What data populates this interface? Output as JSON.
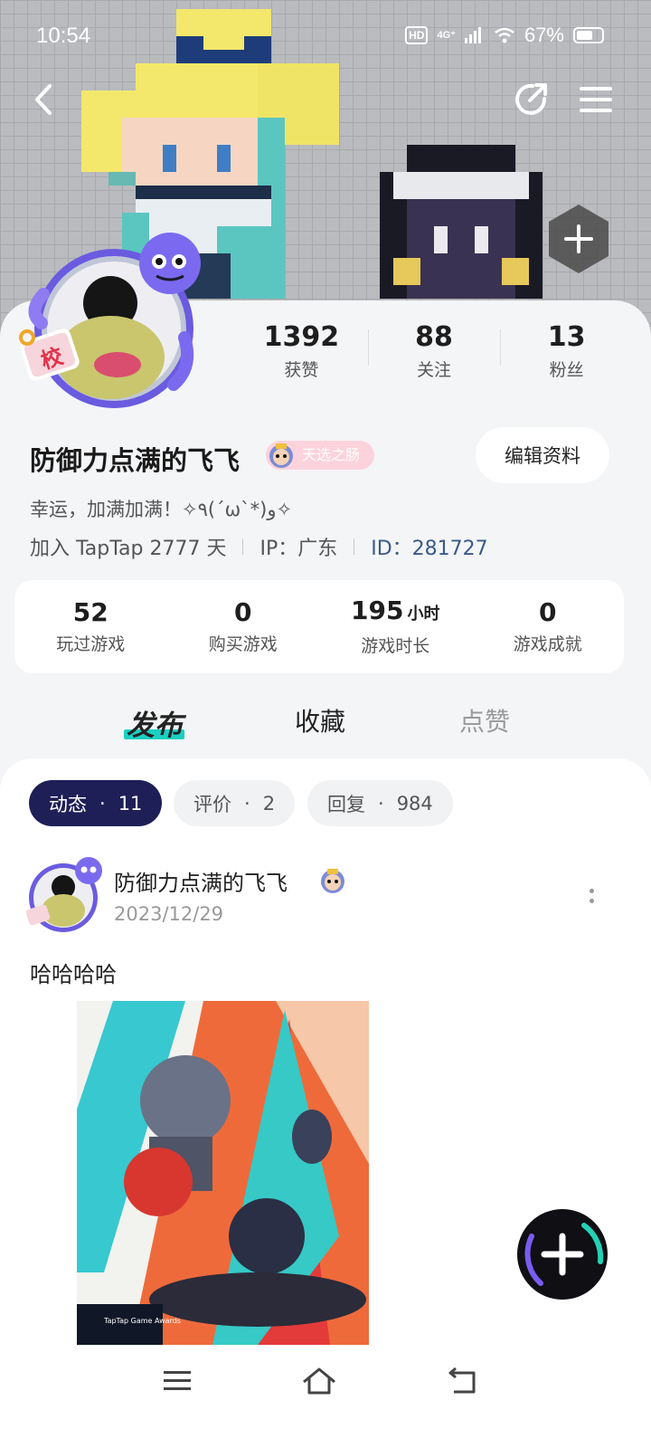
{
  "status_bar": {
    "time": "10:54",
    "hd": "HD",
    "network": "4G⁺",
    "battery": "67%",
    "battery_level": 0.67
  },
  "profile": {
    "stats": [
      {
        "value": "1392",
        "label": "获赞"
      },
      {
        "value": "88",
        "label": "关注"
      },
      {
        "value": "13",
        "label": "粉丝"
      }
    ],
    "username": "防御力点满的飞飞",
    "badge_label": "天选之肠",
    "edit_button": "编辑资料",
    "bio": "幸运，加满加满！✧٩(ˊωˋ*)و✧",
    "joined": "加入 TapTap 2777 天",
    "ip": "IP：广东",
    "id": "ID：281727",
    "avatar_tag": "校"
  },
  "game_stats": [
    {
      "value": "52",
      "unit": "",
      "label": "玩过游戏"
    },
    {
      "value": "0",
      "unit": "",
      "label": "购买游戏"
    },
    {
      "value": "195",
      "unit": "小时",
      "label": "游戏时长"
    },
    {
      "value": "0",
      "unit": "",
      "label": "游戏成就"
    }
  ],
  "tabs": [
    {
      "label": "发布",
      "active": true
    },
    {
      "label": "收藏",
      "active": false
    },
    {
      "label": "点赞",
      "active": false
    }
  ],
  "chips": [
    {
      "label": "动态",
      "dot": "·",
      "count": "11",
      "active": true
    },
    {
      "label": "评价",
      "dot": "·",
      "count": "2",
      "active": false
    },
    {
      "label": "回复",
      "dot": "·",
      "count": "984",
      "active": false
    }
  ],
  "post": {
    "author": "防御力点满的飞飞",
    "date": "2023/12/29",
    "text": "哈哈哈哈",
    "image_caption": "TapTap Game Awards"
  },
  "icons": {
    "back": "back-arrow-icon",
    "share": "share-icon",
    "menu": "menu-icon",
    "add": "add-icon",
    "more": "more-vertical-icon",
    "nav_menu": "nav-menu-icon",
    "nav_home": "home-icon",
    "nav_back": "nav-back-icon"
  },
  "colors": {
    "accent_teal": "#19d0c2",
    "chip_active": "#1e1f57",
    "badge_pink": "#fcd3dd",
    "id_blue": "#3a5a8a"
  }
}
